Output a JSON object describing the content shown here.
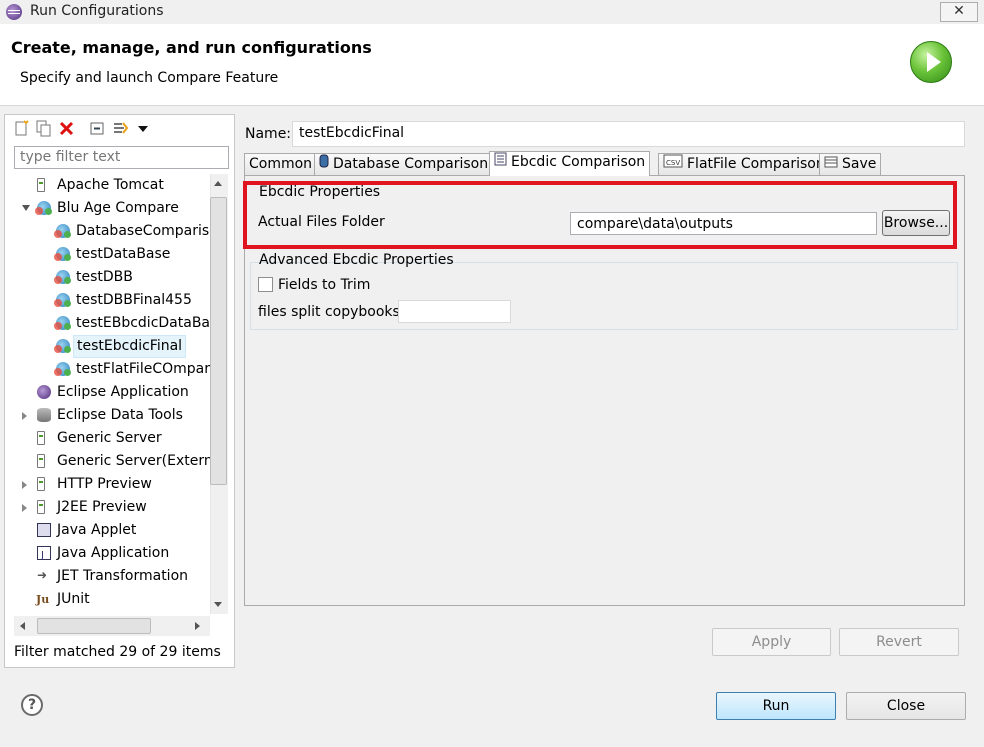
{
  "window": {
    "title": "Run Configurations",
    "close_glyph": "✕"
  },
  "header": {
    "title": "Create, manage, and run configurations",
    "subtitle": "Specify and launch  Compare Feature"
  },
  "left": {
    "filter_placeholder": "type filter text",
    "filter_status": "Filter matched 29 of 29 items",
    "tree": [
      {
        "label": "Apache Tomcat",
        "icon": "server-icon",
        "level": 0,
        "arrow": ""
      },
      {
        "label": "Blu Age Compare",
        "icon": "compare-icon",
        "level": 0,
        "arrow": "open"
      },
      {
        "label": "DatabaseCompariso",
        "icon": "compare-icon",
        "level": 1,
        "arrow": ""
      },
      {
        "label": "testDataBase",
        "icon": "compare-icon",
        "level": 1,
        "arrow": ""
      },
      {
        "label": "testDBB",
        "icon": "compare-icon",
        "level": 1,
        "arrow": ""
      },
      {
        "label": "testDBBFinal455",
        "icon": "compare-icon",
        "level": 1,
        "arrow": ""
      },
      {
        "label": "testEBbcdicDataBas",
        "icon": "compare-icon",
        "level": 1,
        "arrow": ""
      },
      {
        "label": "testEbcdicFinal",
        "icon": "compare-icon",
        "level": 1,
        "arrow": "",
        "selected": true
      },
      {
        "label": "testFlatFileCOmparis",
        "icon": "compare-icon",
        "level": 1,
        "arrow": ""
      },
      {
        "label": "Eclipse Application",
        "icon": "eclipse-icon",
        "level": 0,
        "arrow": ""
      },
      {
        "label": "Eclipse Data Tools",
        "icon": "database-icon",
        "level": 0,
        "arrow": "closed"
      },
      {
        "label": "Generic Server",
        "icon": "server-icon",
        "level": 0,
        "arrow": ""
      },
      {
        "label": "Generic Server(External",
        "icon": "server-icon",
        "level": 0,
        "arrow": ""
      },
      {
        "label": "HTTP Preview",
        "icon": "server-icon",
        "level": 0,
        "arrow": "closed"
      },
      {
        "label": "J2EE Preview",
        "icon": "server-icon",
        "level": 0,
        "arrow": "closed"
      },
      {
        "label": "Java Applet",
        "icon": "applet-icon",
        "level": 0,
        "arrow": ""
      },
      {
        "label": "Java Application",
        "icon": "java-app-icon",
        "level": 0,
        "arrow": ""
      },
      {
        "label": "JET Transformation",
        "icon": "jet-icon",
        "level": 0,
        "arrow": ""
      },
      {
        "label": "JUnit",
        "icon": "junit-icon",
        "level": 0,
        "arrow": ""
      }
    ]
  },
  "config": {
    "name_label": "Name:",
    "name_value": "testEbcdicFinal",
    "tabs": [
      {
        "label": "Common",
        "icon": ""
      },
      {
        "label": "Database Comparison",
        "icon": "database-icon"
      },
      {
        "label": "Ebcdic Comparison",
        "icon": "document-icon",
        "active": true
      },
      {
        "label": "FlatFile Comparison",
        "icon": "csv-icon"
      },
      {
        "label": "Save",
        "icon": "table-icon"
      }
    ],
    "ebcdic_group_title": "Ebcdic Properties",
    "actual_files_label": "Actual Files Folder",
    "actual_files_value": "compare\\data\\outputs",
    "browse_label": "Browse...",
    "advanced_group_title": "Advanced Ebcdic Properties",
    "fields_to_trim_label": "Fields to Trim",
    "fields_to_trim_checked": false,
    "split_copybooks_label": "files split copybooks",
    "split_copybooks_value": ""
  },
  "buttons": {
    "apply": "Apply",
    "revert": "Revert",
    "run": "Run",
    "close": "Close",
    "help_glyph": "?"
  },
  "colors": {
    "highlight": "#e0141e",
    "accent": "#3c7fb1"
  }
}
